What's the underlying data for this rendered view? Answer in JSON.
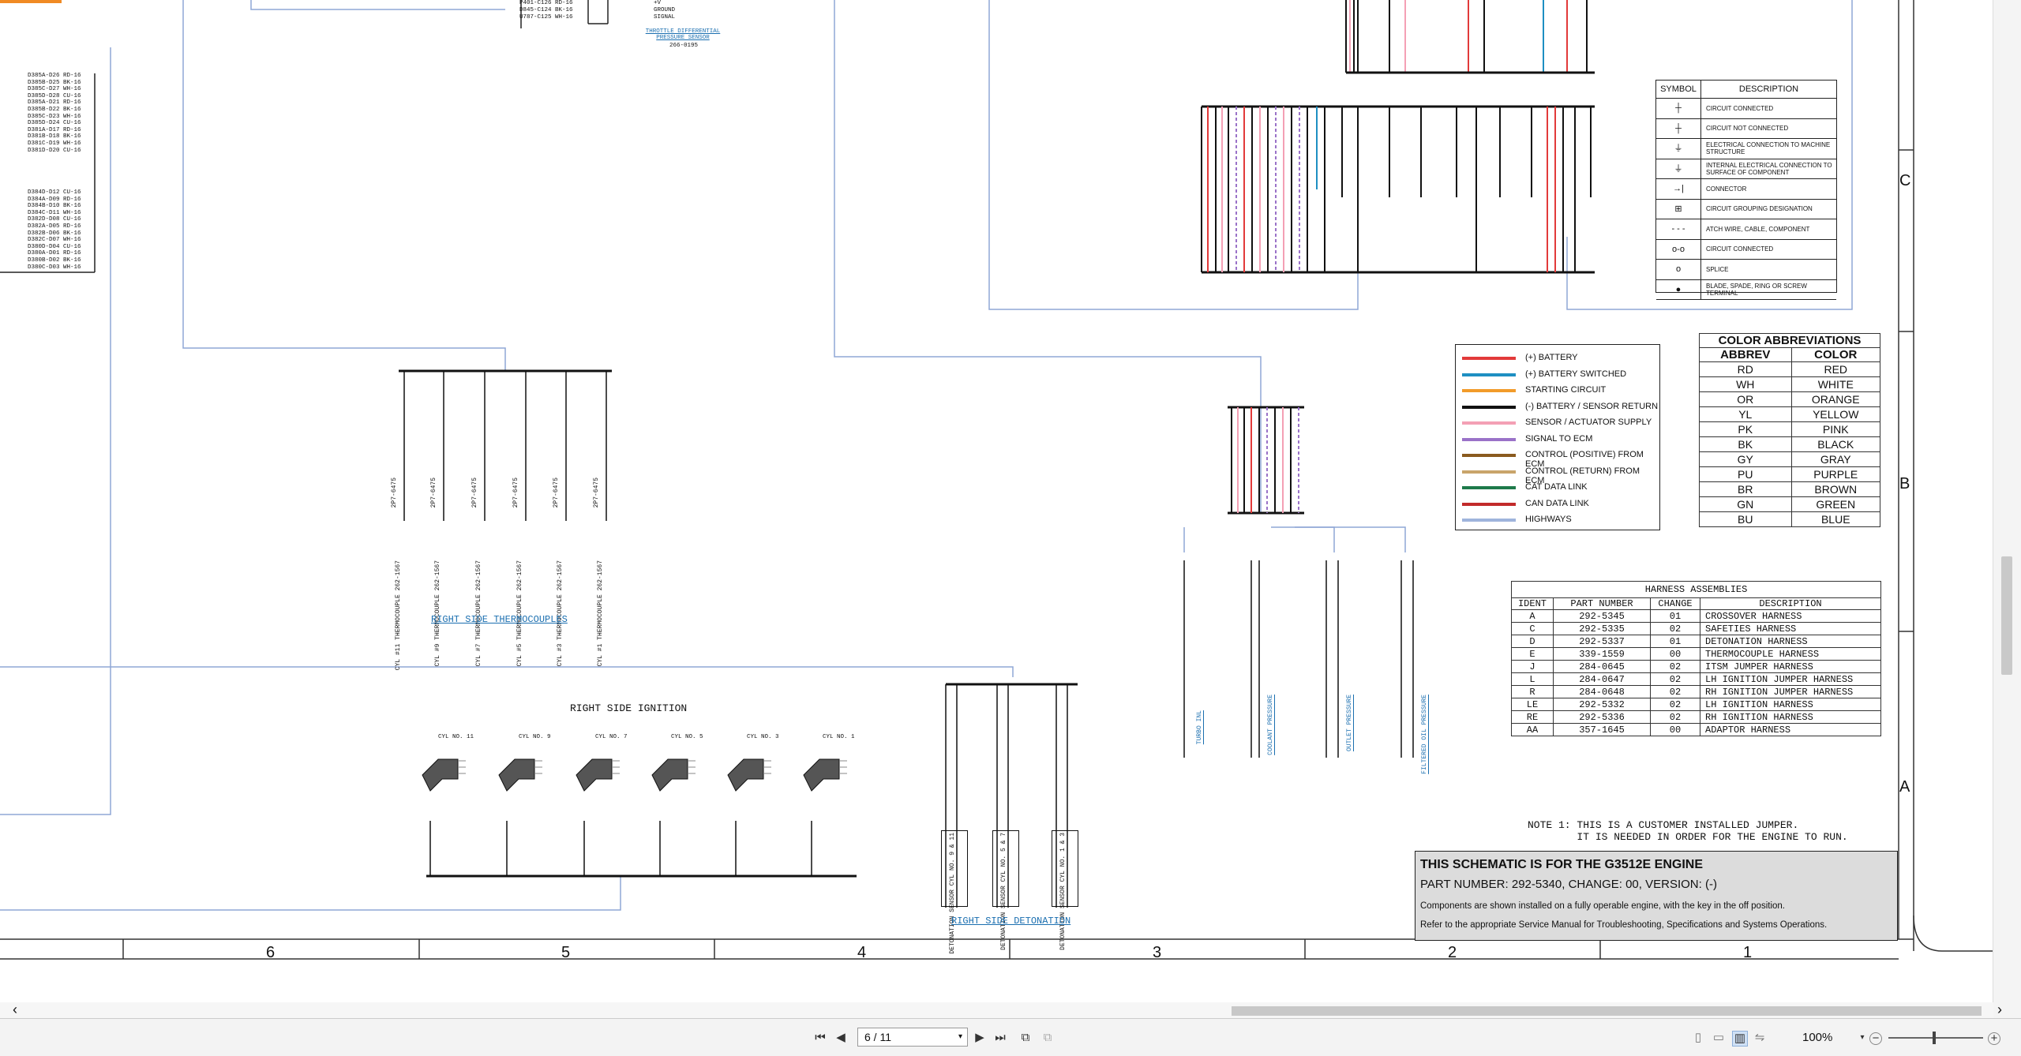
{
  "schematic": {
    "harness_connector_labels": [
      "D385A-D26 RD-16",
      "D385B-D25 BK-16",
      "D385C-D27 WH-16",
      "D385D-D28 CU-16",
      "D385A-D21 RD-16",
      "D385B-D22 BK-16",
      "D385C-D23 WH-16",
      "D385D-D24 CU-16",
      "D381A-D17 RD-16",
      "D381B-D18 BK-16",
      "D381C-D19 WH-16",
      "D381D-D20 CU-16"
    ],
    "harness_connector_labels_2": [
      "D384D-D12 CU-16",
      "D384A-D09 RD-16",
      "D384B-D10 BK-16",
      "D384C-D11 WH-16",
      "D382D-D08 CU-16",
      "D382A-D05 RD-16",
      "D382B-D06 BK-16",
      "D382C-D07 WH-16",
      "D380D-D04 CU-16",
      "D380A-D01 RD-16",
      "D380B-D02 BK-16",
      "D380C-D03 WH-16"
    ],
    "top_sensor_pins": [
      "P401-C126 RD-16",
      "D845-C124 BK-16",
      "U787-C125 WH-16"
    ],
    "top_sensor_pin_labels": [
      "+V",
      "GROUND",
      "SIGNAL"
    ],
    "throttle_sensor_title": "THROTTLE DIFFERENTIAL PRESSURE SENSOR",
    "throttle_sensor_part": "266-0195",
    "thermocouples": [
      {
        "label": "CYL #11 THERMOCOUPLE 262-1567",
        "part": "2P7-6475"
      },
      {
        "label": "CYL #9 THERMOCOUPLE 262-1567",
        "part": "2P7-6475"
      },
      {
        "label": "CYL #7 THERMOCOUPLE 262-1567",
        "part": "2P7-6475"
      },
      {
        "label": "CYL #5 THERMOCOUPLE 262-1567",
        "part": "2P7-6475"
      },
      {
        "label": "CYL #3 THERMOCOUPLE 262-1567",
        "part": "2P7-6475"
      },
      {
        "label": "CYL #1 THERMOCOUPLE 262-1567",
        "part": "2P7-6475"
      }
    ],
    "thermocouples_title": "RIGHT SIDE THERMOCOUPLES",
    "ignition_title": "RIGHT SIDE IGNITION",
    "ignition_cylinders": [
      "CYL NO. 11",
      "CYL NO. 9",
      "CYL NO. 7",
      "CYL NO. 5",
      "CYL NO. 3",
      "CYL NO. 1"
    ],
    "detonation_title": "RIGHT SIDE DETONATION",
    "detonation_sensors": [
      "DETONATION SENSOR CYL NO. 9 & 11",
      "DETONATION SENSOR CYL NO. 5 & 7",
      "DETONATION SENSOR CYL NO. 1 & 3"
    ],
    "sensor_links": [
      "TURBO INL",
      "COOLANT PRESSURE",
      "OUTLET PRESSURE",
      "FILTERED OIL PRESSURE"
    ],
    "note": "NOTE 1: THIS IS A CUSTOMER INSTALLED JUMPER.\n        IT IS NEEDED IN ORDER FOR THE ENGINE TO RUN.",
    "column_numbers": [
      "6",
      "5",
      "4",
      "3",
      "2",
      "1"
    ],
    "row_letters": [
      "C",
      "B",
      "A"
    ]
  },
  "symbol_table": {
    "headers": [
      "SYMBOL",
      "DESCRIPTION"
    ],
    "rows": [
      {
        "symbol": "┼",
        "desc": "CIRCUIT CONNECTED"
      },
      {
        "symbol": "┼",
        "desc": "CIRCUIT NOT CONNECTED"
      },
      {
        "symbol": "⏚",
        "desc": "ELECTRICAL CONNECTION TO MACHINE STRUCTURE"
      },
      {
        "symbol": "⏚",
        "desc": "INTERNAL ELECTRICAL CONNECTION TO SURFACE OF COMPONENT"
      },
      {
        "symbol": "→|",
        "desc": "CONNECTOR"
      },
      {
        "symbol": "⊞",
        "desc": "CIRCUIT GROUPING DESIGNATION"
      },
      {
        "symbol": "- - -",
        "desc": "ATCH WIRE, CABLE, COMPONENT"
      },
      {
        "symbol": "o-o",
        "desc": "CIRCUIT CONNECTED"
      },
      {
        "symbol": "o",
        "desc": "SPLICE"
      },
      {
        "symbol": "●",
        "desc": "BLADE, SPADE, RING OR SCREW TERMINAL"
      }
    ]
  },
  "wire_legend": [
    {
      "label": "(+) BATTERY",
      "color": "#e23a3a"
    },
    {
      "label": "(+) BATTERY SWITCHED",
      "color": "#1e8fc2"
    },
    {
      "label": "STARTING CIRCUIT",
      "color": "#f29b2a"
    },
    {
      "label": "(-) BATTERY / SENSOR RETURN",
      "color": "#111111"
    },
    {
      "label": "SENSOR / ACTUATOR SUPPLY",
      "color": "#f4a0b5"
    },
    {
      "label": "SIGNAL TO ECM",
      "color": "#9a72c8"
    },
    {
      "label": "CONTROL (POSITIVE) FROM ECM",
      "color": "#8a5a1e"
    },
    {
      "label": "CONTROL (RETURN) FROM ECM",
      "color": "#c9a46a"
    },
    {
      "label": "CAT DATA LINK",
      "color": "#1e7a4a"
    },
    {
      "label": "CAN DATA LINK",
      "color": "#c22a2a"
    },
    {
      "label": "HIGHWAYS",
      "color": "#9fb4dc"
    }
  ],
  "color_abbrev": {
    "title": "COLOR ABBREVIATIONS",
    "headers": [
      "ABBREV",
      "COLOR"
    ],
    "rows": [
      [
        "RD",
        "RED"
      ],
      [
        "WH",
        "WHITE"
      ],
      [
        "OR",
        "ORANGE"
      ],
      [
        "YL",
        "YELLOW"
      ],
      [
        "PK",
        "PINK"
      ],
      [
        "BK",
        "BLACK"
      ],
      [
        "GY",
        "GRAY"
      ],
      [
        "PU",
        "PURPLE"
      ],
      [
        "BR",
        "BROWN"
      ],
      [
        "GN",
        "GREEN"
      ],
      [
        "BU",
        "BLUE"
      ]
    ]
  },
  "harness": {
    "title": "HARNESS ASSEMBLIES",
    "headers": [
      "IDENT",
      "PART NUMBER",
      "CHANGE",
      "DESCRIPTION"
    ],
    "rows": [
      [
        "A",
        "292-5345",
        "01",
        "CROSSOVER HARNESS"
      ],
      [
        "C",
        "292-5335",
        "02",
        "SAFETIES HARNESS"
      ],
      [
        "D",
        "292-5337",
        "01",
        "DETONATION HARNESS"
      ],
      [
        "E",
        "339-1559",
        "00",
        "THERMOCOUPLE HARNESS"
      ],
      [
        "J",
        "284-0645",
        "02",
        "ITSM JUMPER HARNESS"
      ],
      [
        "L",
        "284-0647",
        "02",
        "LH IGNITION JUMPER HARNESS"
      ],
      [
        "R",
        "284-0648",
        "02",
        "RH IGNITION JUMPER HARNESS"
      ],
      [
        "LE",
        "292-5332",
        "02",
        "LH IGNITION HARNESS"
      ],
      [
        "RE",
        "292-5336",
        "02",
        "RH IGNITION HARNESS"
      ],
      [
        "AA",
        "357-1645",
        "00",
        "ADAPTOR HARNESS"
      ]
    ]
  },
  "title_block": {
    "heading": "THIS SCHEMATIC IS FOR THE G3512E ENGINE",
    "part": "PART NUMBER: 292-5340, CHANGE: 00, VERSION: (-)",
    "line1": "Components are shown installed on a fully operable engine, with the key in the off position.",
    "line2": "Refer to the appropriate Service Manual for Troubleshooting, Specifications and Systems Operations."
  },
  "toolbar": {
    "first_page": "⏮",
    "prev_page": "◀",
    "page_value": "6 / 11",
    "next_page": "▶",
    "last_page": "⏭",
    "zoom": "100%",
    "scroll_left": "‹",
    "scroll_right": "›",
    "zoom_minus": "−",
    "zoom_plus": "+"
  }
}
